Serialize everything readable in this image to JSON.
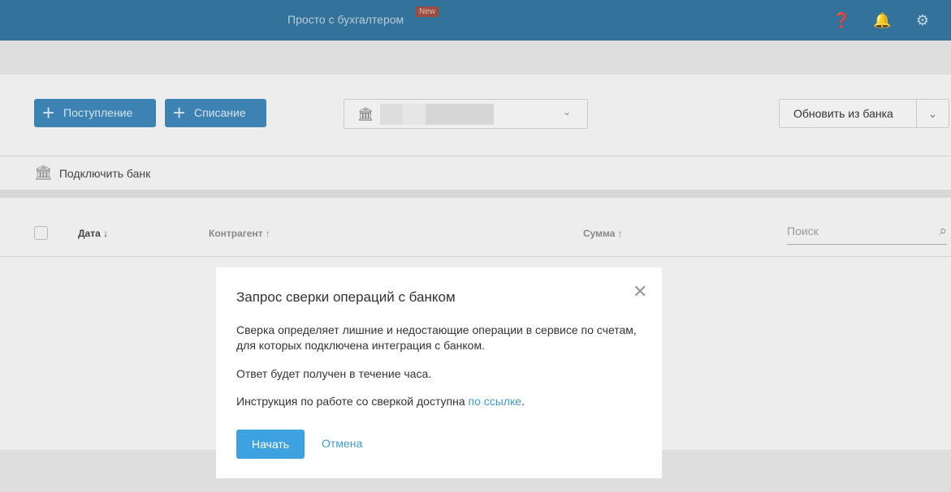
{
  "header": {
    "brand": "Просто с бухгалтером",
    "badge": "New",
    "icons": [
      "help-icon",
      "bell-icon",
      "gear-icon"
    ]
  },
  "toolbar": {
    "income_label": "Поступление",
    "expense_label": "Списание",
    "refresh_label": "Обновить из банка",
    "connect_bank_label": "Подключить банк"
  },
  "table": {
    "columns": [
      "Дата ↓",
      "Контрагент ↑",
      "Сумма ↑"
    ],
    "search_placeholder": "Поиск"
  },
  "modal": {
    "title": "Запрос сверки операций с банком",
    "paragraph1": "Сверка определяет лишние и недостающие операции в сервисе по счетам, для которых подключена интеграция с банком.",
    "paragraph2": "Ответ будет получен в течение часа.",
    "paragraph3_prefix": "Инструкция по работе со сверкой доступна ",
    "paragraph3_link": "по ссылке",
    "paragraph3_suffix": ".",
    "start_label": "Начать",
    "cancel_label": "Отмена"
  }
}
